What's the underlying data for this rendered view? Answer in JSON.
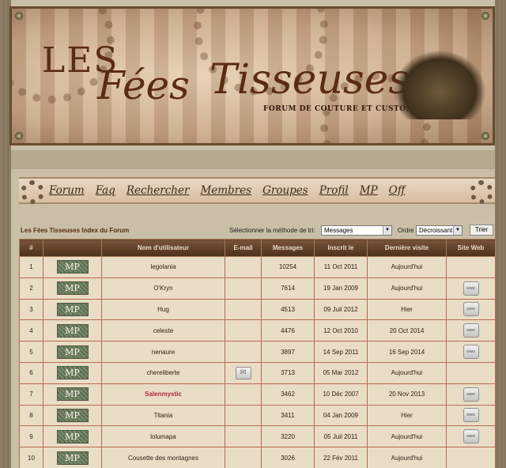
{
  "banner": {
    "les": "LES",
    "fees": "Fées",
    "tisseuses": "Tisseuses",
    "subtitle": "FORUM DE COUTURE ET CUSTOMISATION"
  },
  "nav": {
    "items": [
      "Forum",
      "Faq",
      "Rechercher",
      "Membres",
      "Groupes",
      "Profil",
      "MP",
      "Off"
    ]
  },
  "toolbar": {
    "breadcrumb": "Les Fées Tisseuses Index du Forum",
    "sort_label": "Sélectionner la méthode de tri:",
    "sort_value": "Messages",
    "order_label": "Ordre",
    "order_value": "Décroissant",
    "submit_label": "Trier"
  },
  "table": {
    "headers": [
      "#",
      "",
      "Nom d'utilisateur",
      "E-mail",
      "Messages",
      "Inscrit le",
      "Dernière visite",
      "Site Web"
    ],
    "pm_label": "MP",
    "www_label": "www",
    "rows": [
      {
        "n": "1",
        "name": "legolania",
        "posts": "10254",
        "joined": "11 Oct 2011",
        "last": "Aujourd'hui",
        "email": false,
        "www": false,
        "highlight": false
      },
      {
        "n": "2",
        "name": "O'Kryn",
        "posts": "7614",
        "joined": "19 Jan 2009",
        "last": "Aujourd'hui",
        "email": false,
        "www": true,
        "highlight": false
      },
      {
        "n": "3",
        "name": "Hug",
        "posts": "4513",
        "joined": "09 Juil 2012",
        "last": "Hier",
        "email": false,
        "www": true,
        "highlight": false
      },
      {
        "n": "4",
        "name": "celeste",
        "posts": "4476",
        "joined": "12 Oct 2010",
        "last": "20 Oct 2014",
        "email": false,
        "www": true,
        "highlight": false
      },
      {
        "n": "5",
        "name": "nenaure",
        "posts": "3897",
        "joined": "14 Sep 2011",
        "last": "16 Sep 2014",
        "email": false,
        "www": true,
        "highlight": false
      },
      {
        "n": "6",
        "name": "chereliberte",
        "posts": "3713",
        "joined": "05 Mar 2012",
        "last": "Aujourd'hui",
        "email": true,
        "www": false,
        "highlight": false
      },
      {
        "n": "7",
        "name": "Salenmystic",
        "posts": "3462",
        "joined": "10 Déc 2007",
        "last": "20 Nov 2013",
        "email": false,
        "www": true,
        "highlight": true
      },
      {
        "n": "8",
        "name": "Titania",
        "posts": "3411",
        "joined": "04 Jan 2009",
        "last": "Hier",
        "email": false,
        "www": true,
        "highlight": false
      },
      {
        "n": "9",
        "name": "lolumapa",
        "posts": "3220",
        "joined": "05 Juil 2011",
        "last": "Aujourd'hui",
        "email": false,
        "www": true,
        "highlight": false
      },
      {
        "n": "10",
        "name": "Cousette des montagnes",
        "posts": "3026",
        "joined": "22 Fév 2011",
        "last": "Aujourd'hui",
        "email": false,
        "www": false,
        "highlight": false
      }
    ]
  },
  "colors": {
    "header_bg": "#5e3c24",
    "row_bg": "#e9ddc6",
    "row_border": "#b96a52",
    "highlight_name": "#b0283c",
    "breadcrumb": "#5b2a14"
  }
}
